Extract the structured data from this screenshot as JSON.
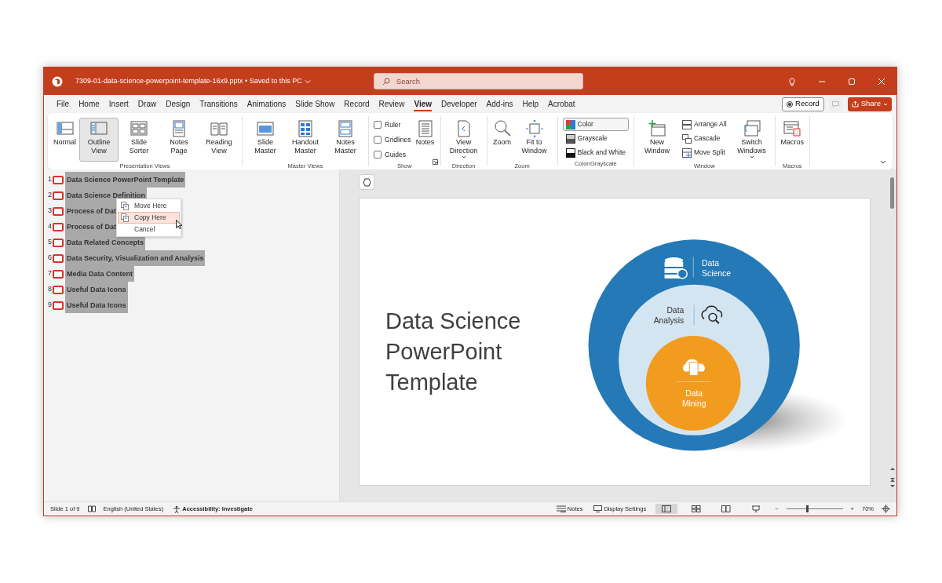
{
  "title_bar": {
    "file_name": "7309-01-data-science-powerpoint-template-16x9.pptx • Saved to this PC",
    "search_placeholder": "Search"
  },
  "menu_tabs": [
    {
      "label": "File",
      "selected": false
    },
    {
      "label": "Home",
      "selected": false
    },
    {
      "label": "Insert",
      "selected": false
    },
    {
      "label": "Draw",
      "selected": false
    },
    {
      "label": "Design",
      "selected": false
    },
    {
      "label": "Transitions",
      "selected": false
    },
    {
      "label": "Animations",
      "selected": false
    },
    {
      "label": "Slide Show",
      "selected": false
    },
    {
      "label": "Record",
      "selected": false
    },
    {
      "label": "Review",
      "selected": false
    },
    {
      "label": "View",
      "selected": true
    },
    {
      "label": "Developer",
      "selected": false
    },
    {
      "label": "Add-ins",
      "selected": false
    },
    {
      "label": "Help",
      "selected": false
    },
    {
      "label": "Acrobat",
      "selected": false
    }
  ],
  "record_button": "Record",
  "share_button": "Share",
  "ribbon_groups": [
    {
      "label": "Presentation Views",
      "items": [
        {
          "kind": "large",
          "label": "Normal",
          "selected": false
        },
        {
          "kind": "large",
          "label": "Outline View",
          "selected": true
        },
        {
          "kind": "large",
          "label": "Slide Sorter",
          "selected": false
        },
        {
          "kind": "large",
          "label": "Notes Page",
          "selected": false
        },
        {
          "kind": "large",
          "label": "Reading View",
          "selected": false
        }
      ]
    },
    {
      "label": "Master Views",
      "items": [
        {
          "kind": "large",
          "label": "Slide Master",
          "selected": false
        },
        {
          "kind": "large",
          "label": "Handout Master",
          "selected": false
        },
        {
          "kind": "large",
          "label": "Notes Master",
          "selected": false
        }
      ]
    },
    {
      "label": "Show",
      "has_launcher": true,
      "items": [
        {
          "kind": "check",
          "label": "Ruler",
          "checked": false
        },
        {
          "kind": "check",
          "label": "Gridlines",
          "checked": false
        },
        {
          "kind": "check",
          "label": "Guides",
          "checked": false
        },
        {
          "kind": "large",
          "label": "Notes",
          "selected": false
        }
      ]
    },
    {
      "label": "Direction",
      "items": [
        {
          "kind": "large",
          "label": "View Direction",
          "selected": false,
          "dropdown": true
        }
      ]
    },
    {
      "label": "Zoom",
      "items": [
        {
          "kind": "large",
          "label": "Zoom",
          "selected": false
        },
        {
          "kind": "large",
          "label": "Fit to Window",
          "selected": false
        }
      ]
    },
    {
      "label": "Color/Grayscale",
      "items": [
        {
          "kind": "small",
          "label": "Color",
          "selected": true
        },
        {
          "kind": "small",
          "label": "Grayscale",
          "selected": false
        },
        {
          "kind": "small",
          "label": "Black and White",
          "selected": false
        }
      ]
    },
    {
      "label": "Window",
      "items": [
        {
          "kind": "large",
          "label": "New Window",
          "selected": false
        },
        {
          "kind": "small",
          "label": "Arrange All",
          "selected": false
        },
        {
          "kind": "small",
          "label": "Cascade",
          "selected": false
        },
        {
          "kind": "small",
          "label": "Move Split",
          "selected": false
        },
        {
          "kind": "large",
          "label": "Switch Windows",
          "selected": false,
          "dropdown": true
        }
      ]
    },
    {
      "label": "Macros",
      "items": [
        {
          "kind": "large",
          "label": "Macros",
          "selected": false
        }
      ]
    }
  ],
  "outline": [
    {
      "number": "1",
      "title": "Data Science PowerPoint Template"
    },
    {
      "number": "2",
      "title": "Data Science Definition"
    },
    {
      "number": "3",
      "title": "Process of Dat"
    },
    {
      "number": "4",
      "title": "Process of Dat"
    },
    {
      "number": "5",
      "title": "Data Related Concepts"
    },
    {
      "number": "6",
      "title": "Data Security, Visualization and Analysis"
    },
    {
      "number": "7",
      "title": "Media Data Content"
    },
    {
      "number": "8",
      "title": "Useful Data Icons"
    },
    {
      "number": "9",
      "title": "Useful Data Icons"
    }
  ],
  "context_menu": [
    {
      "label": "Move Here",
      "selected": false
    },
    {
      "label": "Copy Here",
      "selected": true
    },
    {
      "label": "Cancel",
      "selected": false
    }
  ],
  "slide": {
    "title": "Data Science PowerPoint Template",
    "outer_label": [
      "Data",
      "Science"
    ],
    "middle_label": [
      "Data",
      "Analysis"
    ],
    "inner_label": [
      "Data",
      "Mining"
    ]
  },
  "status_bar": {
    "slide_count": "Slide 1 of 9",
    "language": "English (United States)",
    "accessibility": "Accessibility: Investigate",
    "notes": "Notes",
    "display_settings": "Display Settings",
    "zoom_out": "−",
    "zoom_slider": {
      "level": 0.35
    },
    "zoom_in": "+",
    "zoom": "70%"
  }
}
